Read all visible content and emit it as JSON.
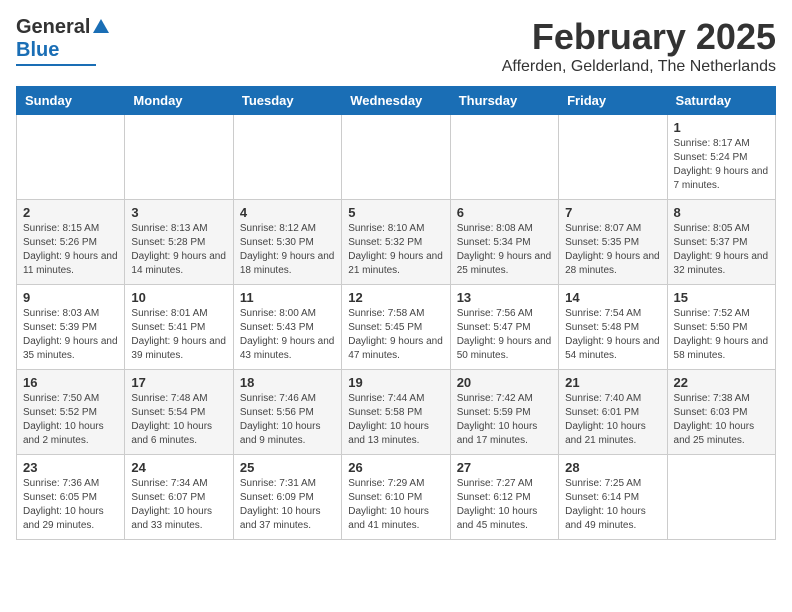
{
  "header": {
    "logo_general": "General",
    "logo_blue": "Blue",
    "month_title": "February 2025",
    "location": "Afferden, Gelderland, The Netherlands"
  },
  "weekdays": [
    "Sunday",
    "Monday",
    "Tuesday",
    "Wednesday",
    "Thursday",
    "Friday",
    "Saturday"
  ],
  "weeks": [
    [
      {
        "day": "",
        "info": ""
      },
      {
        "day": "",
        "info": ""
      },
      {
        "day": "",
        "info": ""
      },
      {
        "day": "",
        "info": ""
      },
      {
        "day": "",
        "info": ""
      },
      {
        "day": "",
        "info": ""
      },
      {
        "day": "1",
        "info": "Sunrise: 8:17 AM\nSunset: 5:24 PM\nDaylight: 9 hours and 7 minutes."
      }
    ],
    [
      {
        "day": "2",
        "info": "Sunrise: 8:15 AM\nSunset: 5:26 PM\nDaylight: 9 hours and 11 minutes."
      },
      {
        "day": "3",
        "info": "Sunrise: 8:13 AM\nSunset: 5:28 PM\nDaylight: 9 hours and 14 minutes."
      },
      {
        "day": "4",
        "info": "Sunrise: 8:12 AM\nSunset: 5:30 PM\nDaylight: 9 hours and 18 minutes."
      },
      {
        "day": "5",
        "info": "Sunrise: 8:10 AM\nSunset: 5:32 PM\nDaylight: 9 hours and 21 minutes."
      },
      {
        "day": "6",
        "info": "Sunrise: 8:08 AM\nSunset: 5:34 PM\nDaylight: 9 hours and 25 minutes."
      },
      {
        "day": "7",
        "info": "Sunrise: 8:07 AM\nSunset: 5:35 PM\nDaylight: 9 hours and 28 minutes."
      },
      {
        "day": "8",
        "info": "Sunrise: 8:05 AM\nSunset: 5:37 PM\nDaylight: 9 hours and 32 minutes."
      }
    ],
    [
      {
        "day": "9",
        "info": "Sunrise: 8:03 AM\nSunset: 5:39 PM\nDaylight: 9 hours and 35 minutes."
      },
      {
        "day": "10",
        "info": "Sunrise: 8:01 AM\nSunset: 5:41 PM\nDaylight: 9 hours and 39 minutes."
      },
      {
        "day": "11",
        "info": "Sunrise: 8:00 AM\nSunset: 5:43 PM\nDaylight: 9 hours and 43 minutes."
      },
      {
        "day": "12",
        "info": "Sunrise: 7:58 AM\nSunset: 5:45 PM\nDaylight: 9 hours and 47 minutes."
      },
      {
        "day": "13",
        "info": "Sunrise: 7:56 AM\nSunset: 5:47 PM\nDaylight: 9 hours and 50 minutes."
      },
      {
        "day": "14",
        "info": "Sunrise: 7:54 AM\nSunset: 5:48 PM\nDaylight: 9 hours and 54 minutes."
      },
      {
        "day": "15",
        "info": "Sunrise: 7:52 AM\nSunset: 5:50 PM\nDaylight: 9 hours and 58 minutes."
      }
    ],
    [
      {
        "day": "16",
        "info": "Sunrise: 7:50 AM\nSunset: 5:52 PM\nDaylight: 10 hours and 2 minutes."
      },
      {
        "day": "17",
        "info": "Sunrise: 7:48 AM\nSunset: 5:54 PM\nDaylight: 10 hours and 6 minutes."
      },
      {
        "day": "18",
        "info": "Sunrise: 7:46 AM\nSunset: 5:56 PM\nDaylight: 10 hours and 9 minutes."
      },
      {
        "day": "19",
        "info": "Sunrise: 7:44 AM\nSunset: 5:58 PM\nDaylight: 10 hours and 13 minutes."
      },
      {
        "day": "20",
        "info": "Sunrise: 7:42 AM\nSunset: 5:59 PM\nDaylight: 10 hours and 17 minutes."
      },
      {
        "day": "21",
        "info": "Sunrise: 7:40 AM\nSunset: 6:01 PM\nDaylight: 10 hours and 21 minutes."
      },
      {
        "day": "22",
        "info": "Sunrise: 7:38 AM\nSunset: 6:03 PM\nDaylight: 10 hours and 25 minutes."
      }
    ],
    [
      {
        "day": "23",
        "info": "Sunrise: 7:36 AM\nSunset: 6:05 PM\nDaylight: 10 hours and 29 minutes."
      },
      {
        "day": "24",
        "info": "Sunrise: 7:34 AM\nSunset: 6:07 PM\nDaylight: 10 hours and 33 minutes."
      },
      {
        "day": "25",
        "info": "Sunrise: 7:31 AM\nSunset: 6:09 PM\nDaylight: 10 hours and 37 minutes."
      },
      {
        "day": "26",
        "info": "Sunrise: 7:29 AM\nSunset: 6:10 PM\nDaylight: 10 hours and 41 minutes."
      },
      {
        "day": "27",
        "info": "Sunrise: 7:27 AM\nSunset: 6:12 PM\nDaylight: 10 hours and 45 minutes."
      },
      {
        "day": "28",
        "info": "Sunrise: 7:25 AM\nSunset: 6:14 PM\nDaylight: 10 hours and 49 minutes."
      },
      {
        "day": "",
        "info": ""
      }
    ]
  ]
}
